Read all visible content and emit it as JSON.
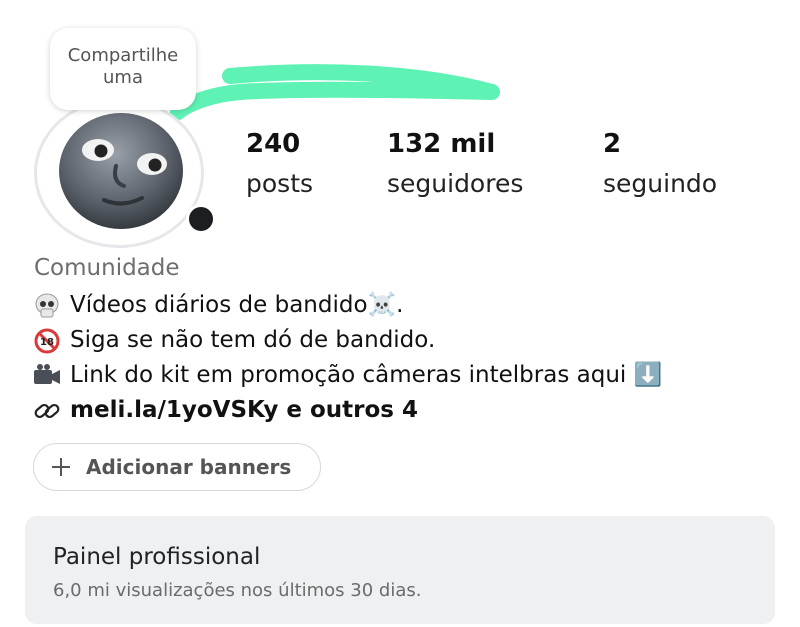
{
  "note": {
    "text": "Compartilhe uma"
  },
  "stats": [
    {
      "value": "240",
      "label": "posts"
    },
    {
      "value": "132 mil",
      "label": "seguidores"
    },
    {
      "value": "2",
      "label": "seguindo"
    }
  ],
  "profile": {
    "category": "Comunidade",
    "bio_lines": [
      {
        "icon": "skull-icon",
        "text": "Vídeos diários de bandido☠️."
      },
      {
        "icon": "no-under-18-icon",
        "text": "Siga se não tem dó de bandido."
      },
      {
        "icon": "video-camera-icon",
        "text": "Link do kit em promoção câmeras intelbras aqui ⬇️"
      }
    ],
    "link": {
      "icon": "link-icon",
      "text": "meli.la/1yoVSKy e outros 4"
    }
  },
  "actions": {
    "add_banners": "Adicionar banners"
  },
  "professional_panel": {
    "title": "Painel profissional",
    "subtitle": "6,0 mi visualizações nos últimos 30 dias."
  },
  "colors": {
    "scribble": "#5ef2b4",
    "panel_bg": "#eff0f2",
    "category": "#6e6e6e"
  }
}
